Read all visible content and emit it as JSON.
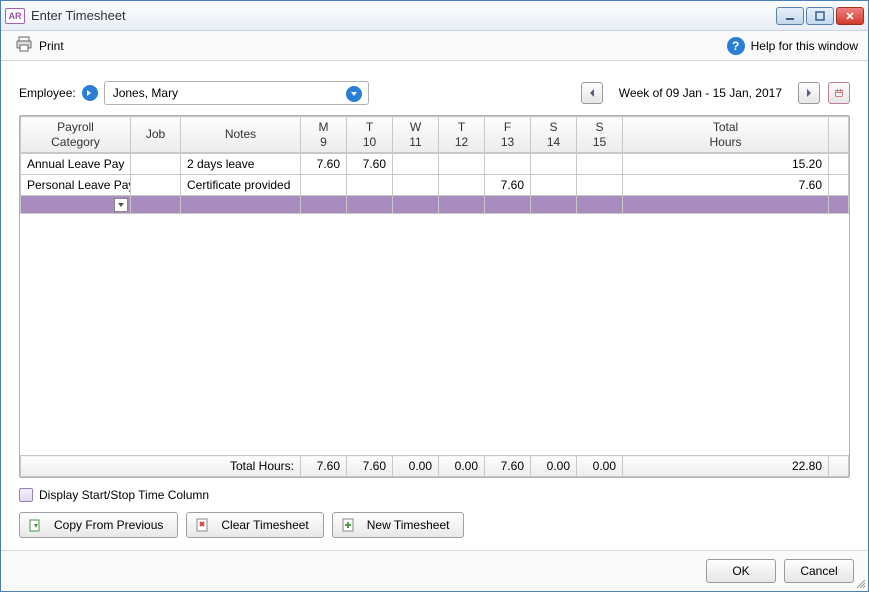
{
  "window": {
    "title": "Enter Timesheet",
    "app_badge": "AR"
  },
  "toolbar": {
    "print": "Print",
    "help": "Help for this window"
  },
  "employee": {
    "label": "Employee:",
    "name": "Jones, Mary"
  },
  "week": {
    "label": "Week of 09 Jan - 15 Jan, 2017"
  },
  "columns": {
    "payroll_category": "Payroll\nCategory",
    "job": "Job",
    "notes": "Notes",
    "days": [
      {
        "d": "M",
        "n": "9"
      },
      {
        "d": "T",
        "n": "10"
      },
      {
        "d": "W",
        "n": "11"
      },
      {
        "d": "T",
        "n": "12"
      },
      {
        "d": "F",
        "n": "13"
      },
      {
        "d": "S",
        "n": "14"
      },
      {
        "d": "S",
        "n": "15"
      }
    ],
    "total": "Total\nHours"
  },
  "rows": [
    {
      "category": "Annual Leave Pay",
      "job": "",
      "notes": "2 days leave",
      "hours": [
        "7.60",
        "7.60",
        "",
        "",
        "",
        "",
        ""
      ],
      "total": "15.20"
    },
    {
      "category": "Personal Leave Pay",
      "job": "",
      "notes": "Certificate provided",
      "hours": [
        "",
        "",
        "",
        "",
        "7.60",
        "",
        ""
      ],
      "total": "7.60"
    }
  ],
  "totals": {
    "label": "Total Hours:",
    "hours": [
      "7.60",
      "7.60",
      "0.00",
      "0.00",
      "7.60",
      "0.00",
      "0.00"
    ],
    "grand": "22.80"
  },
  "options": {
    "display_start_stop": "Display Start/Stop Time Column"
  },
  "buttons": {
    "copy_prev": "Copy From Previous",
    "clear": "Clear Timesheet",
    "new": "New Timesheet",
    "ok": "OK",
    "cancel": "Cancel"
  }
}
